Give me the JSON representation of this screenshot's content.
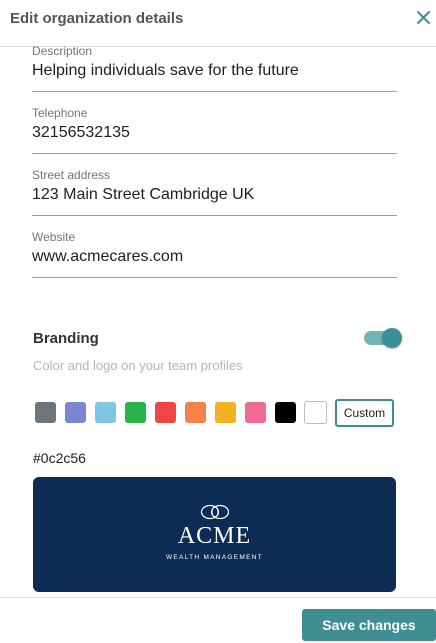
{
  "header": {
    "title": "Edit organization details"
  },
  "fields": [
    {
      "label": "Description",
      "value": "Helping individuals save for the future"
    },
    {
      "label": "Telephone",
      "value": "32156532135"
    },
    {
      "label": "Street address",
      "value": "123 Main Street Cambridge UK"
    },
    {
      "label": "Website",
      "value": "www.acmecares.com"
    }
  ],
  "branding": {
    "title": "Branding",
    "subtitle": "Color and logo on your team profiles",
    "enabled": true,
    "swatches": [
      "#6d757e",
      "#7b86d3",
      "#7ec6e2",
      "#27b44a",
      "#f04545",
      "#f5824c",
      "#f4b121",
      "#ef6b91",
      "#000000",
      "#ffffff"
    ],
    "custom_label": "Custom",
    "selected_color": "#0c2c56",
    "logo": {
      "name": "ACME",
      "tagline": "WEALTH MANAGEMENT"
    }
  },
  "footer": {
    "save_label": "Save changes"
  },
  "colors": {
    "accent": "#3f8f92",
    "toggle_track": "#74b3b3",
    "toggle_knob": "#3a9095"
  }
}
